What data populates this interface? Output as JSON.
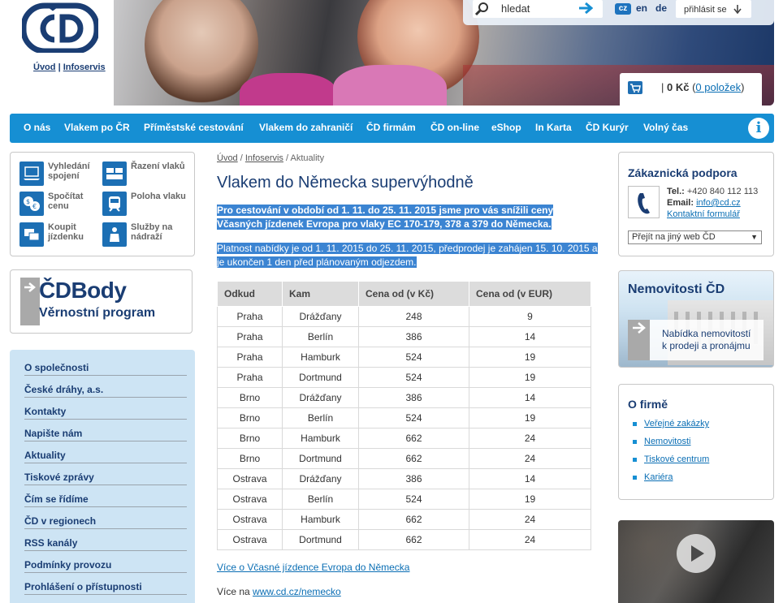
{
  "header": {
    "links": [
      "Úvod",
      "Infoservis"
    ],
    "search": {
      "placeholder": "hledat",
      "value": "hledat"
    },
    "languages": [
      "cz",
      "en",
      "de"
    ],
    "login_label": "přihlásit se",
    "cart": {
      "amount": "0 Kč",
      "count": "0 položek"
    }
  },
  "nav": {
    "items": [
      "O nás",
      "Vlakem po ČR",
      "Příměstské cestování",
      "Vlakem do zahraničí",
      "ČD firmám",
      "ČD on-line",
      "eShop",
      "In Karta",
      "ČD Kurýr",
      "Volný čas"
    ],
    "info_glyph": "i"
  },
  "quick_links": [
    {
      "label": "Vyhledání spojení",
      "icon": "laptop-icon"
    },
    {
      "label": "Řazení vlaků",
      "icon": "train-composition-icon"
    },
    {
      "label": "Spočítat cenu",
      "icon": "currency-icon"
    },
    {
      "label": "Poloha vlaku",
      "icon": "train-front-icon"
    },
    {
      "label": "Koupit jízdenku",
      "icon": "ticket-icon"
    },
    {
      "label": "Služby na nádraží",
      "icon": "station-staff-icon"
    }
  ],
  "body_banner": {
    "title": "ČDBody",
    "subtitle": "Věrnostní program"
  },
  "left_menu": [
    "O společnosti",
    "České dráhy, a.s.",
    "Kontakty",
    "Napište nám",
    "Aktuality",
    "Tiskové zprávy",
    "Čím se řídíme",
    "ČD v regionech",
    "RSS kanály",
    "Podmínky provozu",
    "Prohlášení o přístupnosti"
  ],
  "breadcrumb": {
    "home": "Úvod",
    "section": "Infoservis",
    "current": "Aktuality"
  },
  "article": {
    "title": "Vlakem do Německa supervýhodně",
    "para1": "Pro cestování v období od 1. 11. do 25. 11. 2015 jsme pro vás snížili ceny Včasných jízdenek Evropa pro vlaky EC 170-179, 378 a 379 do Německa.",
    "para2": "Platnost nabídky je od 1. 11. 2015 do 25. 11. 2015, předprodej je zahájen 15. 10. 2015 a je ukončen 1 den před plánovaným odjezdem.",
    "table": {
      "headers": [
        "Odkud",
        "Kam",
        "Cena od (v Kč)",
        "Cena od (v EUR)"
      ],
      "rows": [
        [
          "Praha",
          "Drážďany",
          "248",
          "9"
        ],
        [
          "Praha",
          "Berlín",
          "386",
          "14"
        ],
        [
          "Praha",
          "Hamburk",
          "524",
          "19"
        ],
        [
          "Praha",
          "Dortmund",
          "524",
          "19"
        ],
        [
          "Brno",
          "Drážďany",
          "386",
          "14"
        ],
        [
          "Brno",
          "Berlín",
          "524",
          "19"
        ],
        [
          "Brno",
          "Hamburk",
          "662",
          "24"
        ],
        [
          "Brno",
          "Dortmund",
          "662",
          "24"
        ],
        [
          "Ostrava",
          "Drážďany",
          "386",
          "14"
        ],
        [
          "Ostrava",
          "Berlín",
          "524",
          "19"
        ],
        [
          "Ostrava",
          "Hamburk",
          "662",
          "24"
        ],
        [
          "Ostrava",
          "Dortmund",
          "662",
          "24"
        ]
      ]
    },
    "more_link": "Více o Včasné jízdence Evropa do Německa",
    "more_prefix": "Více na ",
    "more_url": "www.cd.cz/nemecko"
  },
  "support": {
    "title": "Zákaznická podpora",
    "tel_label": "Tel.:",
    "tel": "+420 840 112 113",
    "email_label": "Email:",
    "email": "info@cd.cz",
    "form_link": "Kontaktní formulář",
    "select_value": "Přejít na jiný web ČD"
  },
  "nemovitosti": {
    "title": "Nemovitosti ČD",
    "text_line1": "Nabídka nemovitostí",
    "text_line2": "k prodeji a pronájmu"
  },
  "firm": {
    "title": "O firmě",
    "items": [
      "Veřejné zakázky",
      "Nemovitosti",
      "Tiskové centrum",
      "Kariéra"
    ]
  },
  "colors": {
    "brand": "#1a3d73",
    "nav": "#168fd3",
    "selection": "#3b84d2",
    "menu_bg": "#cde4f4"
  }
}
